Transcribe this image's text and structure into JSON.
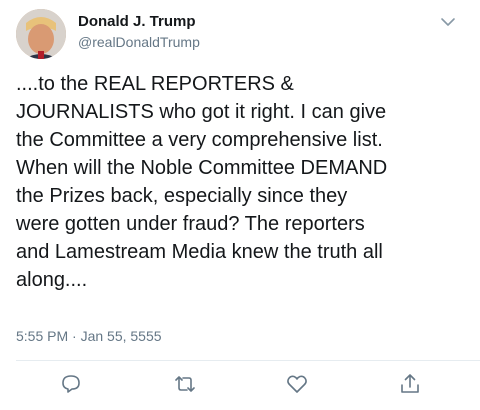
{
  "author": {
    "display_name": "Donald J. Trump",
    "handle": "@realDonaldTrump"
  },
  "tweet": {
    "text": "....to the REAL REPORTERS &\nJOURNALISTS who got it right. I can give\nthe Committee a very comprehensive list.\nWhen will the Noble Committee DEMAND\nthe Prizes back, especially since they\nwere gotten under fraud? The reporters\nand Lamestream Media knew the truth all\nalong....",
    "timestamp": "5:55 PM · Jan 55, 5555"
  },
  "icons": {
    "menu": "chevron-down-icon",
    "reply": "reply-icon",
    "retweet": "retweet-icon",
    "like": "heart-icon",
    "share": "share-icon"
  },
  "colors": {
    "text": "#14171a",
    "secondary": "#657786",
    "icon": "#657786",
    "divider": "#e6ecf0"
  }
}
